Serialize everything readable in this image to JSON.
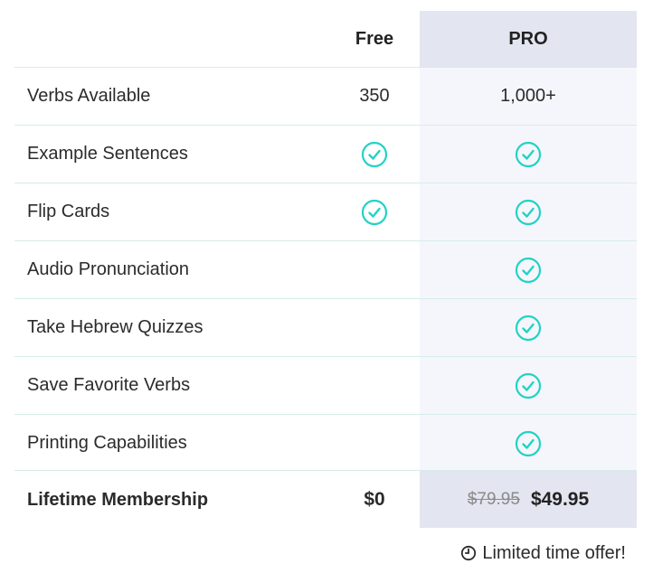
{
  "header": {
    "free_label": "Free",
    "pro_label": "PRO"
  },
  "rows": [
    {
      "label": "Verbs Available",
      "free": "350",
      "pro": "1,000+"
    },
    {
      "label": "Example Sentences",
      "free_check": true,
      "pro_check": true
    },
    {
      "label": "Flip Cards",
      "free_check": true,
      "pro_check": true
    },
    {
      "label": "Audio Pronunciation",
      "free_check": false,
      "pro_check": true
    },
    {
      "label": "Take Hebrew Quizzes",
      "free_check": false,
      "pro_check": true
    },
    {
      "label": "Save Favorite Verbs",
      "free_check": false,
      "pro_check": true
    },
    {
      "label": "Printing Capabilities",
      "free_check": false,
      "pro_check": true
    }
  ],
  "footer": {
    "label": "Lifetime Membership",
    "free_price": "$0",
    "pro_old_price": "$79.95",
    "pro_price": "$49.95"
  },
  "offer": {
    "text": "Limited time offer!",
    "icon": "clock-icon"
  },
  "colors": {
    "check": "#22d3c5",
    "pro_bg": "#f5f6fc",
    "pro_head_bg": "#e3e5f0",
    "divider": "#d6ece9"
  }
}
